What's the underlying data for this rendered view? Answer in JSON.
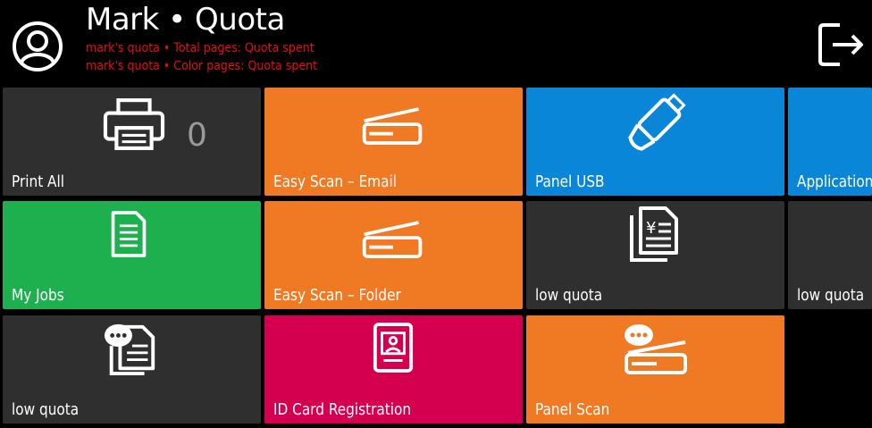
{
  "header": {
    "title": "Mark • Quota",
    "quota_lines": [
      "mark's quota • Total pages: Quota spent",
      "mark's quota • Color pages: Quota spent"
    ],
    "quota_color": "#e0100f",
    "user_icon": "user-circle-icon",
    "logout_icon": "logout-icon"
  },
  "tiles": [
    {
      "label": "Print All",
      "icon": "printer-icon",
      "count": "0",
      "color": "#2f2f2f"
    },
    {
      "label": "Easy Scan – Email",
      "icon": "scanner-icon",
      "color": "#f07a24"
    },
    {
      "label": "Panel USB",
      "icon": "usb-drive-icon",
      "color": "#0a86d8"
    },
    {
      "label": "Applications",
      "icon": "",
      "color": "#0a86d8"
    },
    {
      "label": "My Jobs",
      "icon": "document-icon",
      "color": "#1eaf4e"
    },
    {
      "label": "Easy Scan – Folder",
      "icon": "scanner-icon",
      "color": "#f07a24"
    },
    {
      "label": "low quota",
      "icon": "yen-document-icon",
      "color": "#2f2f2f"
    },
    {
      "label": "low quota",
      "icon": "",
      "color": "#2f2f2f"
    },
    {
      "label": "low quota",
      "icon": "document-dots-icon",
      "color": "#2f2f2f"
    },
    {
      "label": "ID Card Registration",
      "icon": "id-card-icon",
      "color": "#d4004f"
    },
    {
      "label": "Panel Scan",
      "icon": "scanner-dots-icon",
      "color": "#f07a24"
    }
  ]
}
